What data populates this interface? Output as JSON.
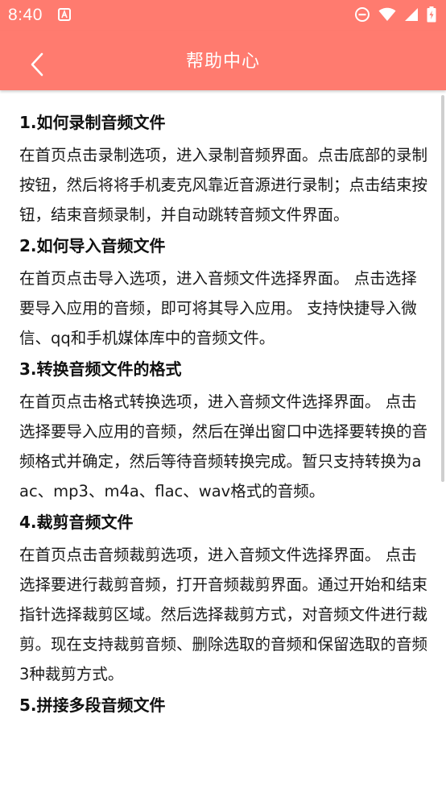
{
  "status_bar": {
    "time": "8:40",
    "colors": {
      "background": "#ff7b6f",
      "icon": "#ffffff"
    },
    "icons": [
      "notification-a-icon",
      "do-not-disturb-icon",
      "wifi-icon",
      "cell-signal-icon",
      "battery-charging-icon"
    ]
  },
  "app_bar": {
    "title": "帮助中心",
    "back_icon": "chevron-left-icon"
  },
  "sections": [
    {
      "title": "1.如何录制音频文件",
      "body": "在首页点击录制选项，进入录制音频界面。点击底部的录制按钮，然后将将手机麦克风靠近音源进行录制；点击结束按钮，结束音频录制，并自动跳转音频文件界面。"
    },
    {
      "title": "2.如何导入音频文件",
      "body": "在首页点击导入选项，进入音频文件选择界面。 点击选择要导入应用的音频，即可将其导入应用。 支持快捷导入微信、qq和手机媒体库中的音频文件。"
    },
    {
      "title": "3.转换音频文件的格式",
      "body": "在首页点击格式转换选项，进入音频文件选择界面。 点击选择要导入应用的音频，然后在弹出窗口中选择要转换的音频格式并确定，然后等待音频转换完成。暂只支持转换为aac、mp3、m4a、flac、wav格式的音频。"
    },
    {
      "title": "4.裁剪音频文件",
      "body": "在首页点击音频裁剪选项，进入音频文件选择界面。 点击选择要进行裁剪音频，打开音频裁剪界面。通过开始和结束指针选择裁剪区域。然后选择裁剪方式，对音频文件进行裁剪。现在支持裁剪音频、删除选取的音频和保留选取的音频3种裁剪方式。"
    },
    {
      "title": "5.拼接多段音频文件",
      "body": ""
    }
  ]
}
